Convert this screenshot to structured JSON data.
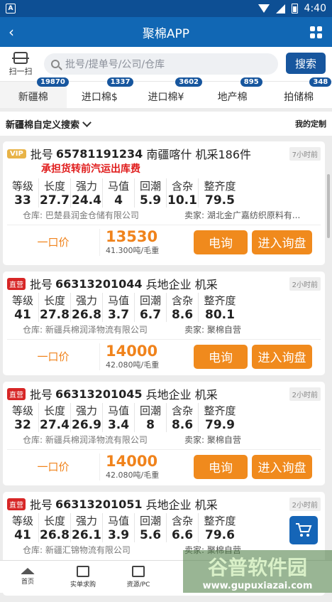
{
  "status": {
    "time": "4:40",
    "app_icon": "A"
  },
  "appbar": {
    "title": "聚棉APP"
  },
  "search": {
    "scan_label": "扫一扫",
    "placeholder": "批号/提单号/公司/仓库",
    "button": "搜索"
  },
  "tabs": [
    {
      "label": "新疆棉",
      "badge": "19870"
    },
    {
      "label": "进口棉$",
      "badge": "1337"
    },
    {
      "label": "进口棉¥",
      "badge": "3602"
    },
    {
      "label": "地产棉",
      "badge": "895"
    },
    {
      "label": "拍储棉",
      "badge": "348"
    }
  ],
  "filter": {
    "label": "新疆棉自定义搜索",
    "mine": "我的定制"
  },
  "spec_labels": [
    "等级",
    "长度",
    "强力",
    "马值",
    "回潮",
    "含杂",
    "整齐度"
  ],
  "cards": [
    {
      "tag": "VIP",
      "batch_prefix": "批号",
      "batch": "65781191234",
      "origin": "南疆喀什",
      "method": "机采186件",
      "time": "7小时前",
      "promo": "承担货转前汽运出库费",
      "values": [
        "33",
        "27.7",
        "24.4",
        "4",
        "5.9",
        "10.1",
        "79.5"
      ],
      "warehouse": "仓库: 巴楚县润金仓储有限公司",
      "seller": "卖家:  湖北金广嘉纺织原料有...",
      "price_label": "一口价",
      "price": "13530",
      "unit": "41.300吨/毛重",
      "call": "电询",
      "inquiry": "进入询盘"
    },
    {
      "tag": "直营",
      "batch_prefix": "批号",
      "batch": "66313201044",
      "origin": "兵地企业",
      "method": "机采",
      "time": "2小时前",
      "values": [
        "41",
        "27.8",
        "26.8",
        "3.7",
        "6.7",
        "8.6",
        "80.1"
      ],
      "warehouse": "仓库: 新疆兵棉润泽物流有限公司",
      "seller": "卖家:  聚棉自营",
      "price_label": "一口价",
      "price": "14000",
      "unit": "42.080吨/毛重",
      "call": "电询",
      "inquiry": "进入询盘"
    },
    {
      "tag": "直营",
      "batch_prefix": "批号",
      "batch": "66313201045",
      "origin": "兵地企业",
      "method": "机采",
      "time": "2小时前",
      "values": [
        "32",
        "27.4",
        "26.9",
        "3.4",
        "8",
        "8.6",
        "79.9"
      ],
      "warehouse": "仓库: 新疆兵棉润泽物流有限公司",
      "seller": "卖家:  聚棉自营",
      "price_label": "一口价",
      "price": "14000",
      "unit": "42.080吨/毛重",
      "call": "电询",
      "inquiry": "进入询盘"
    },
    {
      "tag": "直营",
      "batch_prefix": "批号",
      "batch": "66313201051",
      "origin": "兵地企业",
      "method": "机采",
      "time": "2小时前",
      "values": [
        "41",
        "26.8",
        "26.1",
        "3.9",
        "5.6",
        "6.6",
        "79.6"
      ],
      "warehouse": "仓库: 新疆汇锦物流有限公司",
      "seller": "卖家:  聚棉自营"
    }
  ],
  "bottomnav": [
    {
      "label": "首页",
      "icon": "home-icon"
    },
    {
      "label": "实单求购",
      "icon": "clipboard-icon"
    },
    {
      "label": "资源/PC",
      "icon": "grid-icon"
    }
  ],
  "watermark": {
    "main": "谷普软件园",
    "url": "www.gupuxiazai.com"
  }
}
